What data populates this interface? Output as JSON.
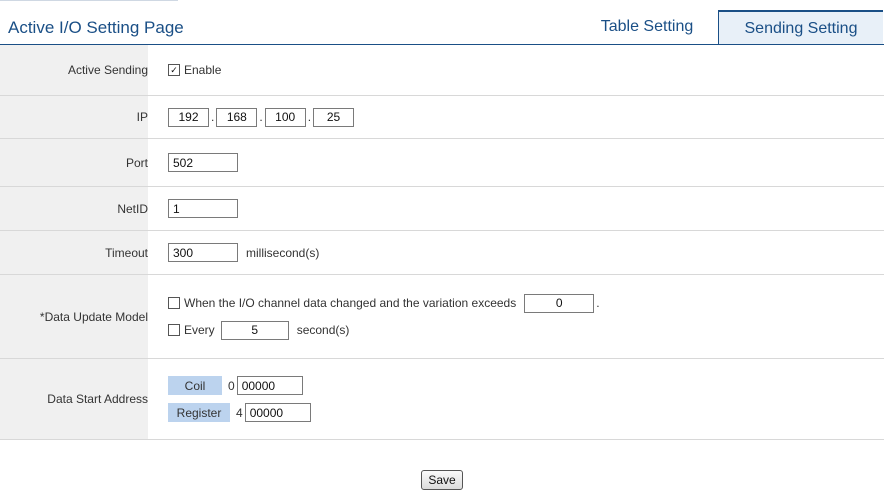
{
  "header": {
    "title": "Active I/O Setting Page",
    "tabs": [
      {
        "label": "Table Setting",
        "active": false
      },
      {
        "label": "Sending Setting",
        "active": true
      }
    ]
  },
  "form": {
    "active_sending": {
      "label": "Active Sending",
      "checkbox_label": "Enable",
      "checked": true
    },
    "ip": {
      "label": "IP",
      "octets": [
        "192",
        "168",
        "100",
        "25"
      ],
      "separator": "."
    },
    "port": {
      "label": "Port",
      "value": "502"
    },
    "netid": {
      "label": "NetID",
      "value": "1"
    },
    "timeout": {
      "label": "Timeout",
      "value": "300",
      "unit": "millisecond(s)"
    },
    "data_update": {
      "label": "*Data Update Model",
      "option1_label": "When the I/O channel data changed and the variation exceeds",
      "option1_value": "0",
      "option1_suffix": ".",
      "option1_checked": false,
      "option2_label": "Every",
      "option2_value": "5",
      "option2_unit": "second(s)",
      "option2_checked": false
    },
    "data_start": {
      "label": "Data Start Address",
      "coil_label": "Coil",
      "coil_prefix": "0",
      "coil_value": "00000",
      "register_label": "Register",
      "register_prefix": "4",
      "register_value": "00000"
    }
  },
  "save_label": "Save",
  "colors": {
    "accent": "#1a4f86",
    "tag_bg": "#bcd3ee",
    "label_bg": "#f0f0f0"
  }
}
